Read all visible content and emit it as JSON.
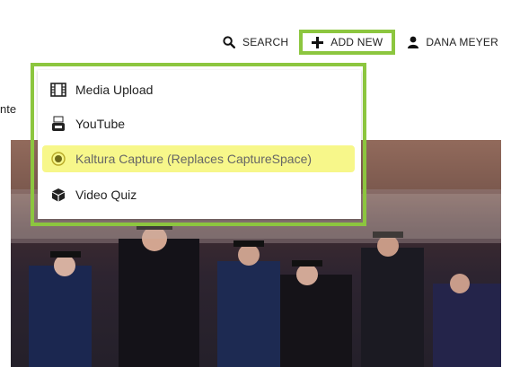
{
  "nav": {
    "search": {
      "label": "SEARCH",
      "icon": "search-icon"
    },
    "add_new": {
      "label": "ADD NEW",
      "icon": "plus-icon",
      "highlight_color": "#8cc63f"
    },
    "user": {
      "label": "DANA MEYER",
      "icon": "user-icon"
    }
  },
  "sidetext": "nte",
  "menu": {
    "items": [
      {
        "label": "Media Upload",
        "icon": "film-icon"
      },
      {
        "label": "YouTube",
        "icon": "youtube-icon"
      },
      {
        "label": "Kaltura Capture (Replaces CaptureSpace)",
        "icon": "record-icon",
        "highlighted": true
      },
      {
        "label": "Video Quiz",
        "icon": "cube-icon"
      }
    ],
    "highlight_color": "#f7f78a",
    "outline_color": "#8cc63f"
  }
}
